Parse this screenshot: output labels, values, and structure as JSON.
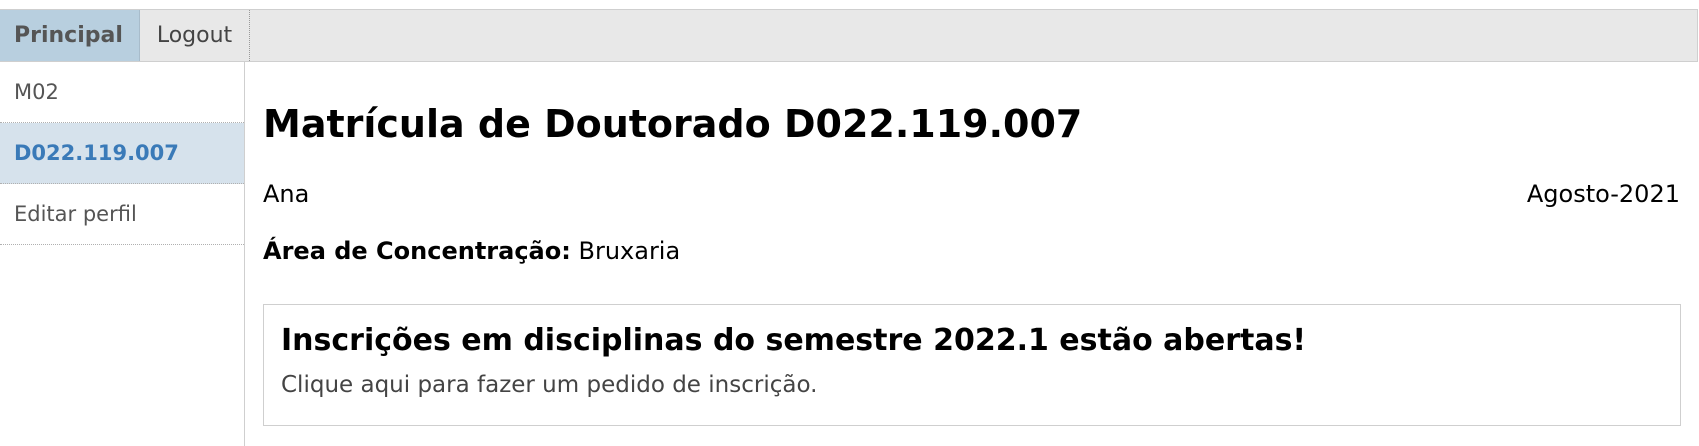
{
  "nav": {
    "tabs": [
      {
        "label": "Principal",
        "active": true
      },
      {
        "label": "Logout",
        "active": false
      }
    ]
  },
  "sidebar": {
    "items": [
      {
        "label": "M02",
        "active": false
      },
      {
        "label": "D022.119.007",
        "active": true
      },
      {
        "label": "Editar perfil",
        "active": false
      }
    ]
  },
  "main": {
    "title": "Matrícula de Doutorado D022.119.007",
    "student_name": "Ana",
    "period": "Agosto-2021",
    "area_label": "Área de Concentração:",
    "area_value": "Bruxaria",
    "notice": {
      "title": "Inscrições em disciplinas do semestre 2022.1 estão abertas!",
      "text": "Clique aqui para fazer um pedido de inscrição."
    }
  },
  "colors": {
    "active_tab_bg": "#b8cfdf",
    "active_sidebar_bg": "#d6e2ec",
    "active_sidebar_text": "#3a7ab8",
    "nav_bg": "#e8e8e8"
  }
}
